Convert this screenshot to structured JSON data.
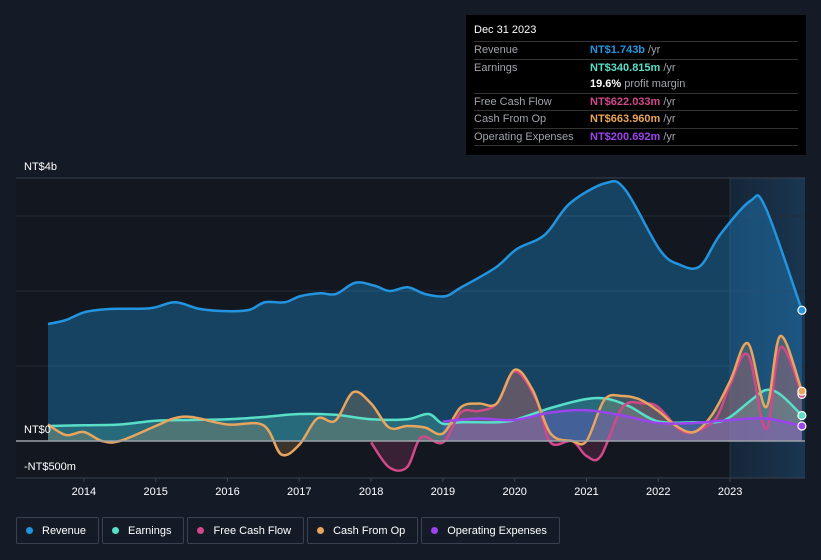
{
  "tooltip": {
    "date": "Dec 31 2023",
    "rows": [
      {
        "label": "Revenue",
        "value": "NT$1.743b",
        "unit": "/yr",
        "color": "#2394df"
      },
      {
        "label": "Earnings",
        "value": "NT$340.815m",
        "unit": "/yr",
        "color": "#58dfc8"
      },
      {
        "label": "",
        "value": "19.6%",
        "unit": "profit margin",
        "color": "#ffffff"
      },
      {
        "label": "Free Cash Flow",
        "value": "NT$622.033m",
        "unit": "/yr",
        "color": "#d1498a"
      },
      {
        "label": "Cash From Op",
        "value": "NT$663.960m",
        "unit": "/yr",
        "color": "#e8a55d"
      },
      {
        "label": "Operating Expenses",
        "value": "NT$200.692m",
        "unit": "/yr",
        "color": "#9b44ee"
      }
    ]
  },
  "legend": [
    {
      "label": "Revenue",
      "color": "#2394df"
    },
    {
      "label": "Earnings",
      "color": "#58dfc8"
    },
    {
      "label": "Free Cash Flow",
      "color": "#d1498a"
    },
    {
      "label": "Cash From Op",
      "color": "#e8a55d"
    },
    {
      "label": "Operating Expenses",
      "color": "#9b44ee"
    }
  ],
  "chart_data": {
    "type": "area",
    "title": "",
    "xlabel": "",
    "ylabel": "",
    "y_unit": "NT$ billions",
    "ylim": [
      -0.5,
      3.5
    ],
    "xlim": [
      2012.55,
      2024.05
    ],
    "y_tick_labels": [
      {
        "value": 4.0,
        "label": "NT$4b"
      },
      {
        "value": 0,
        "label": "NT$0"
      },
      {
        "value": -0.5,
        "label": "-NT$500m"
      }
    ],
    "gridlines": [
      0,
      1,
      2,
      3
    ],
    "x_ticks": [
      2014,
      2015,
      2016,
      2017,
      2018,
      2019,
      2020,
      2021,
      2022,
      2023
    ],
    "highlight_from": 2023.0,
    "grid": true,
    "legend_position": "bottom-left",
    "series": [
      {
        "name": "Revenue",
        "color": "#2394df",
        "x": [
          2013.5,
          2013.74,
          2014.02,
          2014.36,
          2014.92,
          2015.27,
          2015.62,
          2016.03,
          2016.31,
          2016.52,
          2016.8,
          2017.01,
          2017.29,
          2017.51,
          2017.78,
          2018.05,
          2018.26,
          2018.51,
          2018.75,
          2019.03,
          2019.24,
          2019.73,
          2020.03,
          2020.42,
          2020.77,
          2021.27,
          2021.54,
          2022.02,
          2022.3,
          2022.58,
          2022.86,
          2023.28,
          2023.49,
          2024.0
        ],
        "values": [
          1.56,
          1.61,
          1.72,
          1.76,
          1.77,
          1.85,
          1.76,
          1.73,
          1.75,
          1.85,
          1.85,
          1.93,
          1.97,
          1.96,
          2.11,
          2.07,
          2.0,
          2.05,
          1.96,
          1.93,
          2.04,
          2.31,
          2.56,
          2.75,
          3.17,
          3.44,
          3.35,
          2.55,
          2.35,
          2.33,
          2.75,
          3.2,
          3.12,
          1.743
        ]
      },
      {
        "name": "Earnings",
        "color": "#58dfc8",
        "x": [
          2013.5,
          2014.0,
          2014.5,
          2015.0,
          2015.5,
          2016.0,
          2016.5,
          2017.0,
          2017.5,
          2018.0,
          2018.5,
          2018.8,
          2019.0,
          2019.25,
          2019.5,
          2019.75,
          2020.0,
          2020.5,
          2021.0,
          2021.3,
          2021.6,
          2022.0,
          2022.5,
          2022.8,
          2023.0,
          2023.3,
          2023.5,
          2023.7,
          2024.0
        ],
        "values": [
          0.2,
          0.21,
          0.22,
          0.27,
          0.28,
          0.29,
          0.32,
          0.36,
          0.35,
          0.29,
          0.29,
          0.36,
          0.23,
          0.25,
          0.25,
          0.25,
          0.28,
          0.44,
          0.56,
          0.56,
          0.46,
          0.26,
          0.25,
          0.25,
          0.32,
          0.55,
          0.68,
          0.62,
          0.34
        ]
      },
      {
        "name": "Free Cash Flow",
        "color": "#d1498a",
        "x": [
          2018.0,
          2018.25,
          2018.5,
          2018.7,
          2019.0,
          2019.25,
          2019.5,
          2019.75,
          2020.0,
          2020.3,
          2020.5,
          2020.8,
          2021.0,
          2021.2,
          2021.5,
          2021.8,
          2022.0,
          2022.3,
          2022.5,
          2022.8,
          2023.0,
          2023.25,
          2023.5,
          2023.7,
          2024.0
        ],
        "values": [
          -0.02,
          -0.35,
          -0.35,
          0.05,
          -0.02,
          0.38,
          0.4,
          0.5,
          0.93,
          0.55,
          -0.02,
          0.0,
          -0.2,
          -0.2,
          0.45,
          0.5,
          0.45,
          0.15,
          0.12,
          0.3,
          0.75,
          1.15,
          0.16,
          1.25,
          0.622
        ]
      },
      {
        "name": "Cash From Op",
        "color": "#e8a55d",
        "x": [
          2013.5,
          2013.75,
          2014.0,
          2014.25,
          2014.5,
          2015.0,
          2015.25,
          2015.5,
          2016.0,
          2016.5,
          2016.75,
          2017.0,
          2017.25,
          2017.5,
          2017.75,
          2018.0,
          2018.25,
          2018.5,
          2018.75,
          2019.0,
          2019.25,
          2019.5,
          2019.75,
          2020.0,
          2020.25,
          2020.5,
          2020.8,
          2021.0,
          2021.25,
          2021.5,
          2021.75,
          2022.0,
          2022.25,
          2022.5,
          2022.75,
          2023.0,
          2023.25,
          2023.5,
          2023.7,
          2024.0
        ],
        "values": [
          0.22,
          0.08,
          0.12,
          0.0,
          0.0,
          0.2,
          0.3,
          0.32,
          0.22,
          0.21,
          -0.18,
          -0.05,
          0.3,
          0.27,
          0.65,
          0.5,
          0.18,
          0.2,
          0.18,
          0.1,
          0.45,
          0.5,
          0.5,
          0.95,
          0.68,
          0.1,
          0.0,
          0.0,
          0.55,
          0.6,
          0.55,
          0.4,
          0.2,
          0.12,
          0.35,
          0.8,
          1.3,
          0.45,
          1.4,
          0.664
        ]
      },
      {
        "name": "Operating Expenses",
        "color": "#9b44ee",
        "x": [
          2019.0,
          2019.5,
          2020.0,
          2020.5,
          2021.0,
          2021.5,
          2022.0,
          2022.5,
          2023.0,
          2023.5,
          2024.0
        ],
        "values": [
          0.26,
          0.3,
          0.28,
          0.38,
          0.41,
          0.34,
          0.24,
          0.24,
          0.28,
          0.3,
          0.2
        ]
      }
    ]
  }
}
